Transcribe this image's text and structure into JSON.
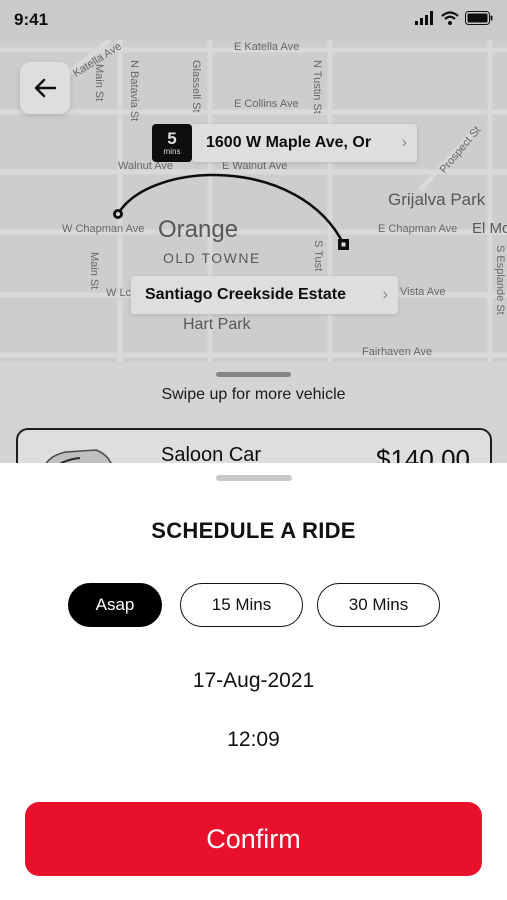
{
  "status_bar": {
    "time": "9:41",
    "icons": [
      "signal-icon",
      "wifi-icon",
      "battery-icon"
    ]
  },
  "map": {
    "streets": {
      "katella_w": "Katella Ave",
      "katella_e": "E Katella Ave",
      "main_st_top": "Main St",
      "batavia": "N Batavia St",
      "glassell": "Glassell St",
      "tustin": "N Tustin St",
      "collins": "E Collins Ave",
      "walnut_w": "Walnut Ave",
      "walnut_e": "E Walnut Ave",
      "prospect": "Prospect St",
      "chapman_w": "W Chapman Ave",
      "chapman_e": "E Chapman Ave",
      "main_st_bottom": "Main St",
      "wl": "W Lc",
      "s_tust": "S Tust",
      "vista": "Vista Ave",
      "esplanade": "S Esplande St",
      "fairhaven": "Fairhaven Ave",
      "el_mo": "El Mo"
    },
    "districts": {
      "grijalva": "Grijalva Park",
      "orange": "Orange",
      "old_towne": "OLD TOWNE",
      "hart_park": "Hart Park"
    },
    "eta": {
      "value": "5",
      "unit": "mins"
    },
    "destination": "1600 W Maple Ave, Or",
    "origin": "Santiago Creekside Estate"
  },
  "vehicles": {
    "swipe_hint": "Swipe up for more vehicle",
    "selected": {
      "name": "Saloon Car",
      "price": "$140.00"
    }
  },
  "schedule": {
    "title": "SCHEDULE A RIDE",
    "options": [
      "Asap",
      "15 Mins",
      "30 Mins"
    ],
    "selected_option": "Asap",
    "date": "17-Aug-2021",
    "time": "12:09",
    "confirm_label": "Confirm"
  },
  "colors": {
    "accent": "#e8102b",
    "chip_active": "#000000"
  }
}
